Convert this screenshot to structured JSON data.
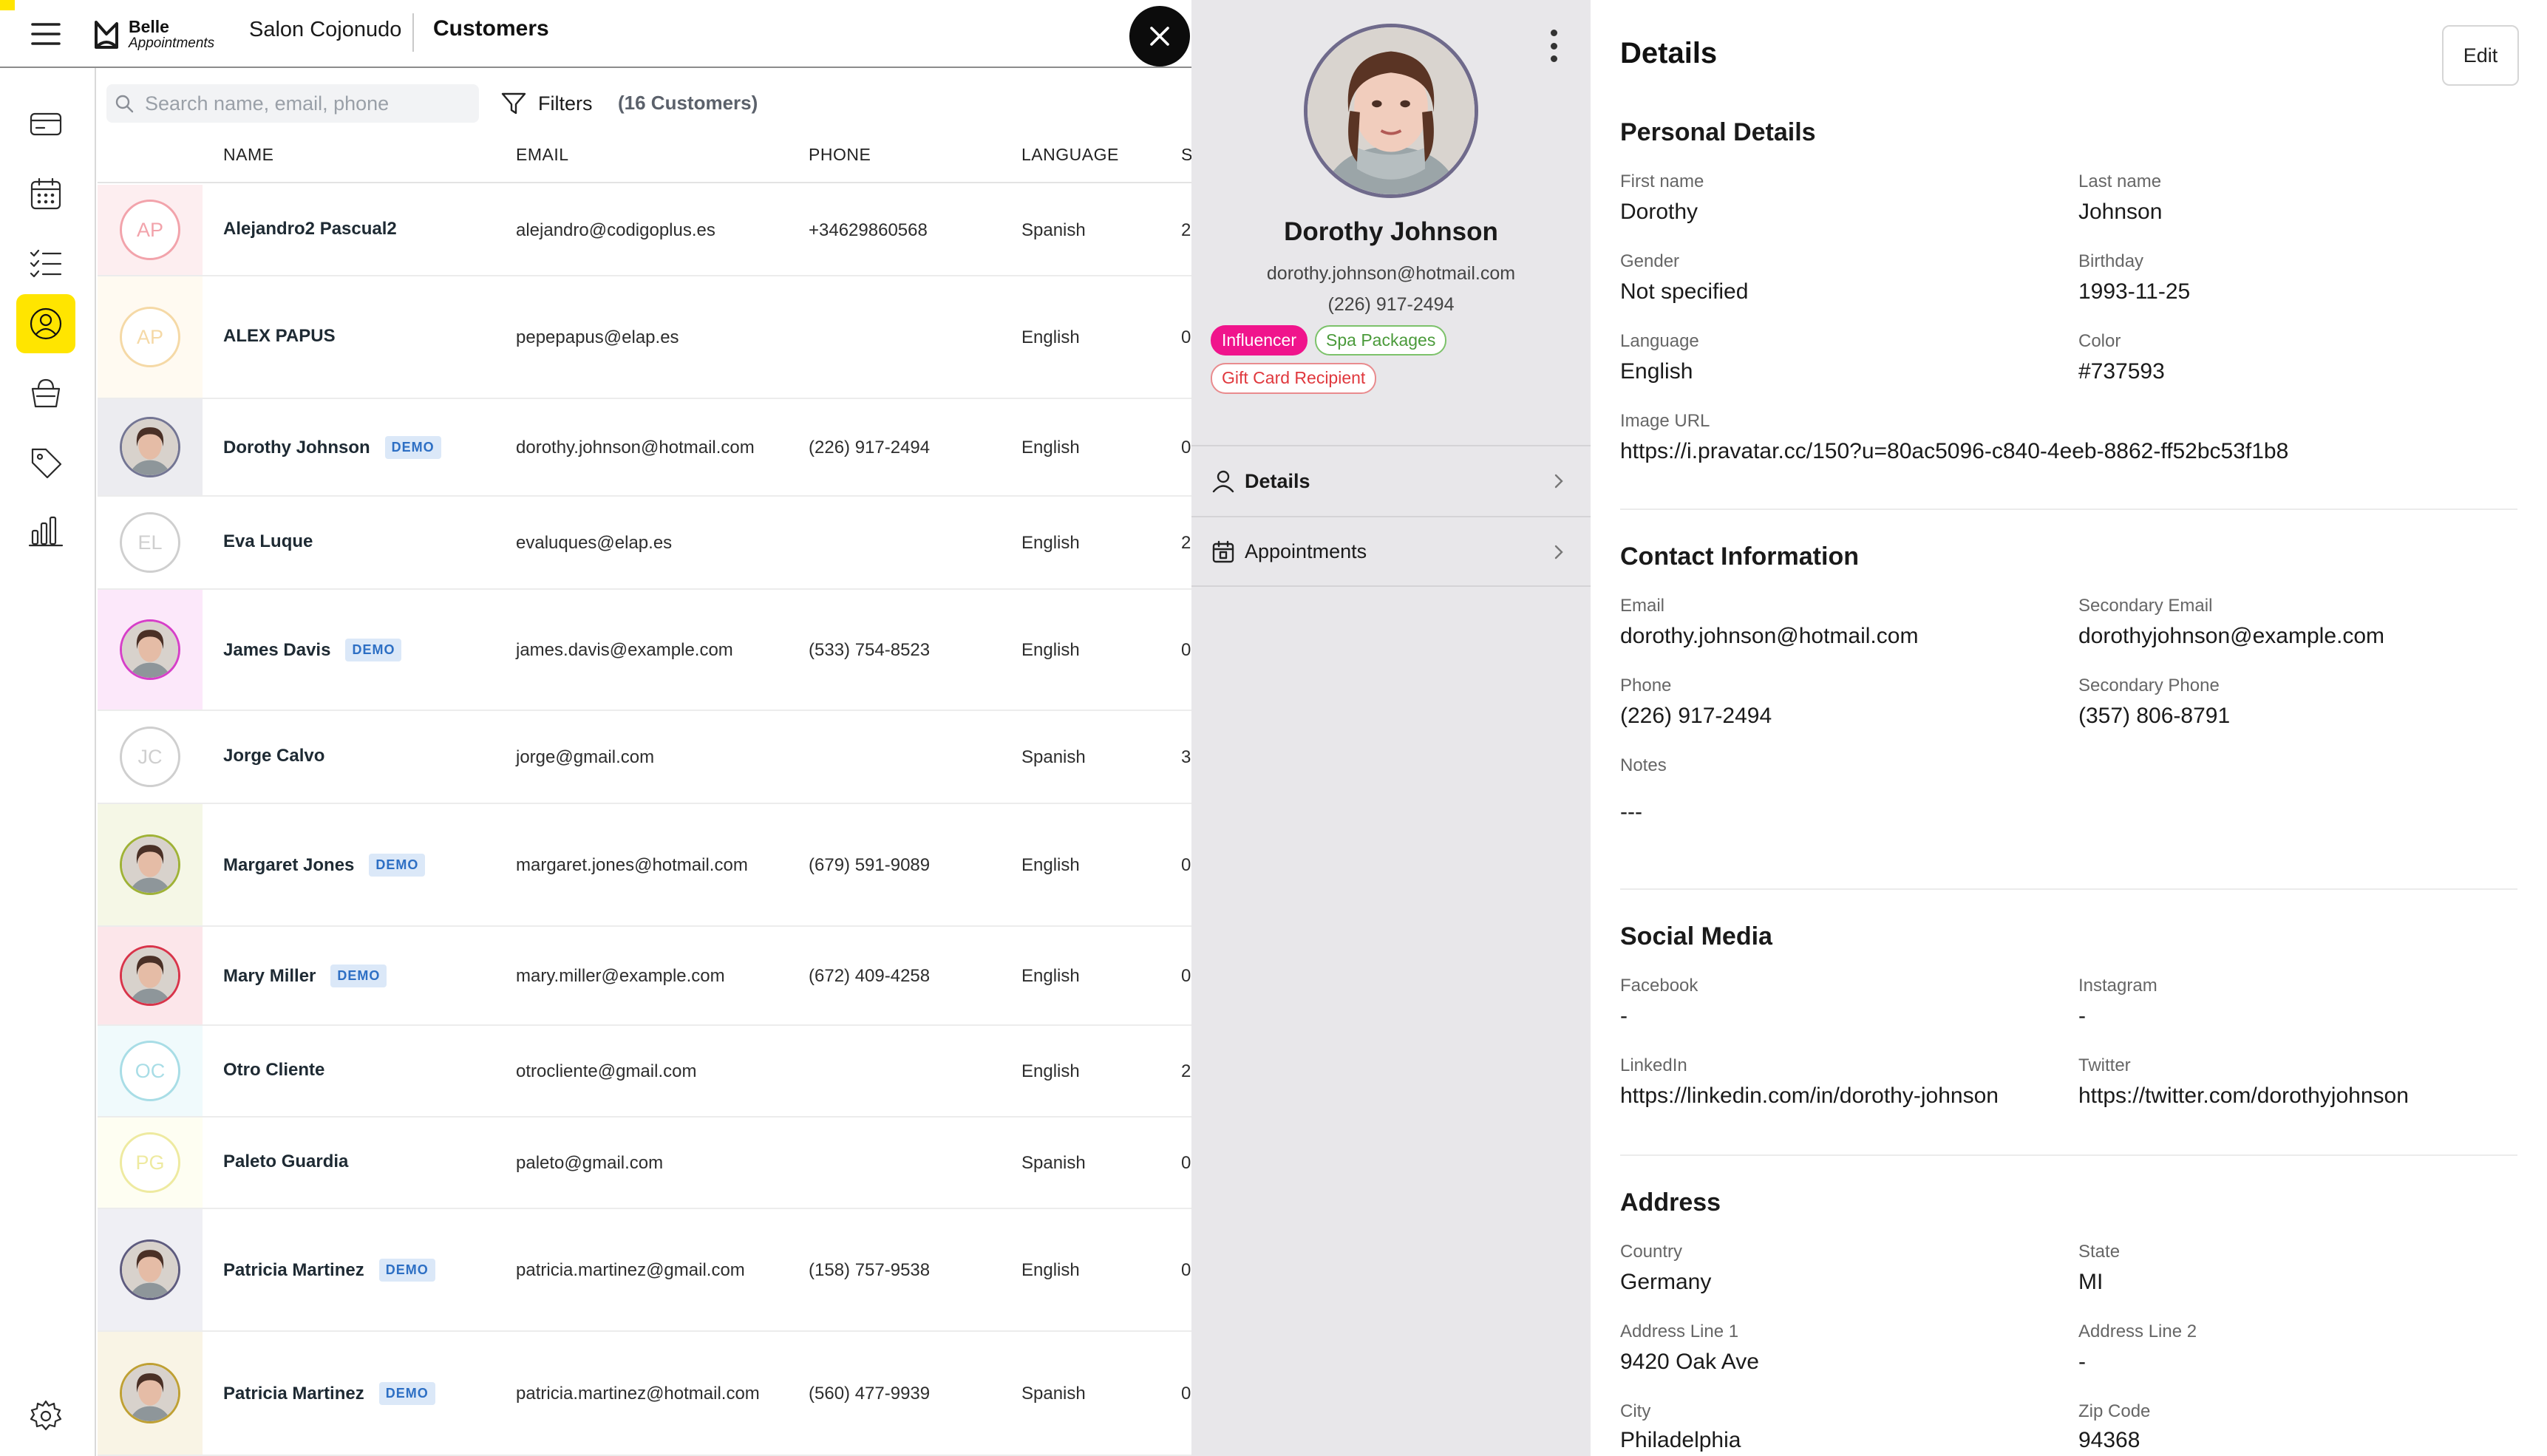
{
  "app": {
    "brand_line1": "Belle",
    "brand_line2": "Appointments",
    "salon": "Salon Cojonudo",
    "page_title": "Customers"
  },
  "list": {
    "search_placeholder": "Search name, email, phone",
    "filters_label": "Filters",
    "count_label": "(16 Customers)",
    "columns": [
      "NAME",
      "EMAIL",
      "PHONE",
      "LANGUAGE",
      "S"
    ],
    "rows": [
      {
        "initials": "AP",
        "name": "Alejandro2 Pascual2",
        "demo": "",
        "email": "alejandro@codigoplus.es",
        "phone": "+34629860568",
        "language": "Spanish",
        "s": "2",
        "color": "#f2a3ab",
        "bg": "#fdeef0"
      },
      {
        "initials": "AP",
        "name": "ALEX PAPUS",
        "demo": "",
        "email": "pepepapus@elap.es",
        "phone": "",
        "language": "English",
        "s": "0",
        "color": "#f5d9a6",
        "bg": "#fffaf1"
      },
      {
        "initials": "",
        "name": "Dorothy Johnson",
        "demo": "DEMO",
        "email": "dorothy.johnson@hotmail.com",
        "phone": "(226) 917-2494",
        "language": "English",
        "s": "0",
        "color": "#737593",
        "bg": "#ececf0"
      },
      {
        "initials": "EL",
        "name": "Eva Luque",
        "demo": "",
        "email": "evaluques@elap.es",
        "phone": "",
        "language": "English",
        "s": "2",
        "color": "#cfcfcf",
        "bg": "#ffffff"
      },
      {
        "initials": "",
        "name": "James Davis",
        "demo": "DEMO",
        "email": "james.davis@example.com",
        "phone": "(533) 754-8523",
        "language": "English",
        "s": "0",
        "color": "#d63fc8",
        "bg": "#fce8fa"
      },
      {
        "initials": "JC",
        "name": "Jorge Calvo",
        "demo": "",
        "email": "jorge@gmail.com",
        "phone": "",
        "language": "Spanish",
        "s": "3",
        "color": "#cfcfcf",
        "bg": "#ffffff"
      },
      {
        "initials": "",
        "name": "Margaret Jones",
        "demo": "DEMO",
        "email": "margaret.jones@hotmail.com",
        "phone": "(679) 591-9089",
        "language": "English",
        "s": "0",
        "color": "#9fb236",
        "bg": "#f5f7e6"
      },
      {
        "initials": "",
        "name": "Mary Miller",
        "demo": "DEMO",
        "email": "mary.miller@example.com",
        "phone": "(672) 409-4258",
        "language": "English",
        "s": "0",
        "color": "#d8344a",
        "bg": "#fce6ea"
      },
      {
        "initials": "OC",
        "name": "Otro Cliente",
        "demo": "",
        "email": "otrocliente@gmail.com",
        "phone": "",
        "language": "English",
        "s": "2",
        "color": "#a8dde6",
        "bg": "#f0fafc"
      },
      {
        "initials": "PG",
        "name": "Paleto Guardia",
        "demo": "",
        "email": "paleto@gmail.com",
        "phone": "",
        "language": "Spanish",
        "s": "0",
        "color": "#eeeaa0",
        "bg": "#fefef2"
      },
      {
        "initials": "",
        "name": "Patricia Martinez",
        "demo": "DEMO",
        "email": "patricia.martinez@gmail.com",
        "phone": "(158) 757-9538",
        "language": "English",
        "s": "0",
        "color": "#5e5b7e",
        "bg": "#efeff4"
      },
      {
        "initials": "",
        "name": "Patricia Martinez",
        "demo": "DEMO",
        "email": "patricia.martinez@hotmail.com",
        "phone": "(560) 477-9939",
        "language": "Spanish",
        "s": "0",
        "color": "#bfa033",
        "bg": "#f9f4e5"
      }
    ]
  },
  "profile": {
    "name": "Dorothy Johnson",
    "email": "dorothy.johnson@hotmail.com",
    "phone": "(226) 917-2494",
    "tags": [
      "Influencer",
      "Spa Packages",
      "Gift Card Recipient"
    ],
    "nav": [
      "Details",
      "Appointments"
    ]
  },
  "details": {
    "title": "Details",
    "edit_label": "Edit",
    "personal": {
      "heading": "Personal Details",
      "first_name_label": "First name",
      "first_name": "Dorothy",
      "last_name_label": "Last name",
      "last_name": "Johnson",
      "gender_label": "Gender",
      "gender": "Not specified",
      "birthday_label": "Birthday",
      "birthday": "1993-11-25",
      "language_label": "Language",
      "language": "English",
      "color_label": "Color",
      "color": "#737593",
      "image_url_label": "Image URL",
      "image_url": "https://i.pravatar.cc/150?u=80ac5096-c840-4eeb-8862-ff52bc53f1b8"
    },
    "contact": {
      "heading": "Contact Information",
      "email_label": "Email",
      "email": "dorothy.johnson@hotmail.com",
      "secondary_email_label": "Secondary Email",
      "secondary_email": "dorothyjohnson@example.com",
      "phone_label": "Phone",
      "phone": "(226) 917-2494",
      "secondary_phone_label": "Secondary Phone",
      "secondary_phone": "(357) 806-8791",
      "notes_label": "Notes",
      "notes": "---"
    },
    "social": {
      "heading": "Social Media",
      "facebook_label": "Facebook",
      "facebook": "-",
      "instagram_label": "Instagram",
      "instagram": "-",
      "linkedin_label": "LinkedIn",
      "linkedin": "https://linkedin.com/in/dorothy-johnson",
      "twitter_label": "Twitter",
      "twitter": "https://twitter.com/dorothyjohnson"
    },
    "address": {
      "heading": "Address",
      "country_label": "Country",
      "country": "Germany",
      "state_label": "State",
      "state": "MI",
      "line1_label": "Address Line 1",
      "line1": "9420 Oak Ave",
      "line2_label": "Address Line 2",
      "line2": "-",
      "city_label": "City",
      "city": "Philadelphia",
      "zip_label": "Zip Code",
      "zip": "94368"
    }
  },
  "colors": {
    "accent": "#ffe500",
    "demo_bg": "#dbe8f8",
    "demo_text": "#2d6fc4",
    "influencer": "#f0148c"
  }
}
